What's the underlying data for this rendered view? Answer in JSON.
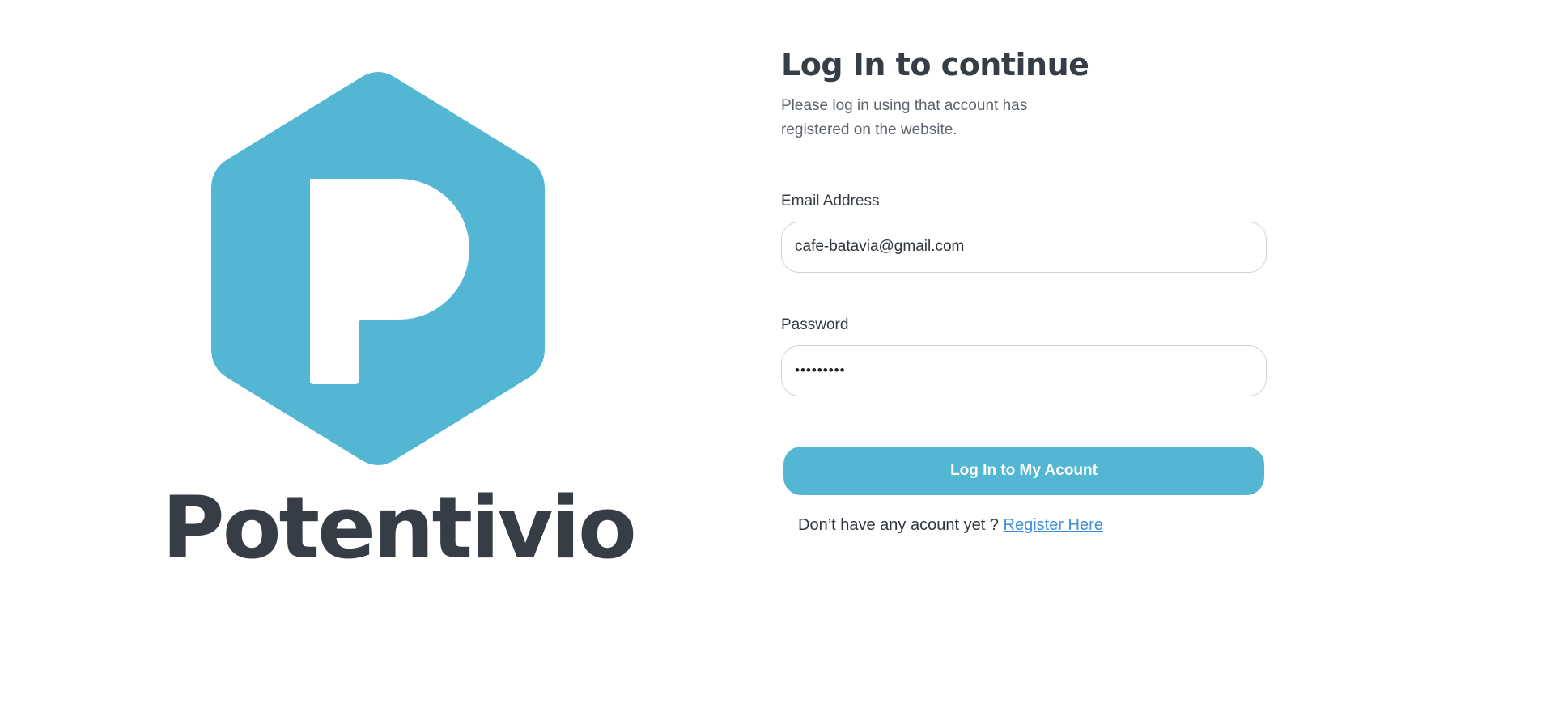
{
  "brand": {
    "name": "Potentivio",
    "logo_icon": "hexagon-p-logo-icon",
    "logo_color": "#53b7d3",
    "text_color": "#363d47"
  },
  "login": {
    "title": "Log In to continue",
    "subtitle": "Please log in using that account has registered on the website.",
    "email_label": "Email Address",
    "email_value": "cafe-batavia@gmail.com",
    "password_label": "Password",
    "password_value": "•••••••••",
    "submit_label": "Log In to My Acount",
    "register_prompt": "Don’t have any acount yet ?",
    "register_link": "Register Here",
    "accent_color": "#53b7d3",
    "link_color": "#3d8fd9"
  }
}
